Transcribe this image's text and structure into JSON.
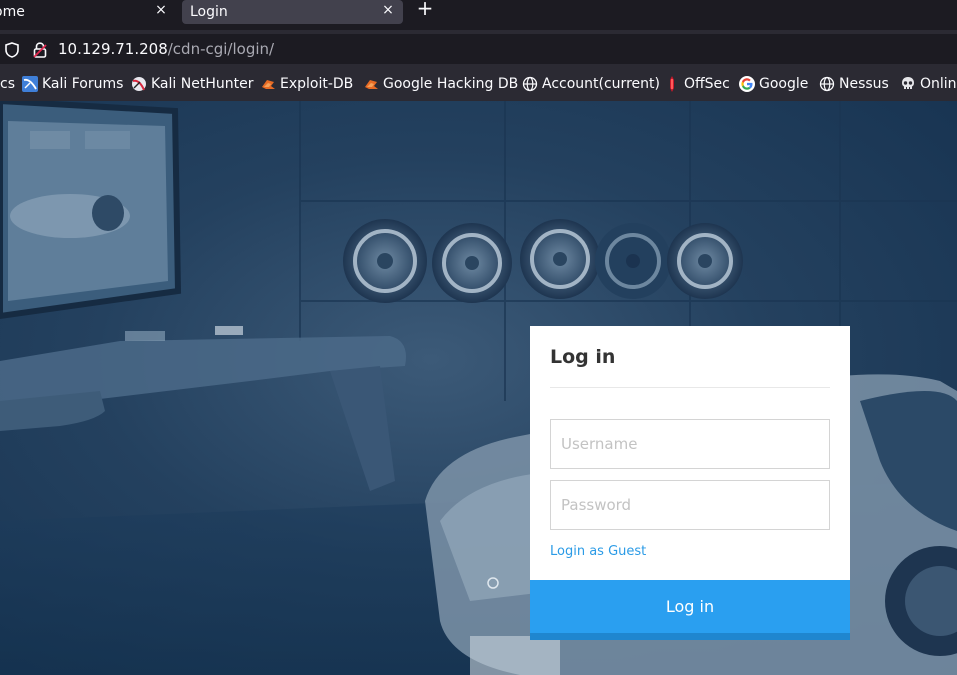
{
  "tabs": [
    {
      "title": "ome",
      "close": "×",
      "active": false
    },
    {
      "title": "Login",
      "close": "×",
      "active": true
    }
  ],
  "new_tab_label": "+",
  "address_bar": {
    "host": "10.129.71.208",
    "path": "/cdn-cgi/login/"
  },
  "bookmarks": [
    {
      "label": "cs",
      "icon": "none"
    },
    {
      "label": "Kali Forums",
      "icon": "kali-forums-icon"
    },
    {
      "label": "Kali NetHunter",
      "icon": "kali-nethunter-icon"
    },
    {
      "label": "Exploit-DB",
      "icon": "exploit-db-icon"
    },
    {
      "label": "Google Hacking DB",
      "icon": "exploit-db-icon"
    },
    {
      "label": "Account(current)",
      "icon": "globe-icon"
    },
    {
      "label": "OffSec",
      "icon": "offsec-icon"
    },
    {
      "label": "Google",
      "icon": "google-icon"
    },
    {
      "label": "Nessus",
      "icon": "globe-icon"
    },
    {
      "label": "Onlin",
      "icon": "skull-icon"
    }
  ],
  "login": {
    "heading": "Log in",
    "username_placeholder": "Username",
    "password_placeholder": "Password",
    "guest_link": "Login as Guest",
    "submit_label": "Log in"
  },
  "colors": {
    "tab_bar": "#1c1b22",
    "toolbar": "#2b2a33",
    "page_background": "#1f3d5c",
    "login_button": "#2a9ff0",
    "guest_link": "#2b9be6"
  }
}
